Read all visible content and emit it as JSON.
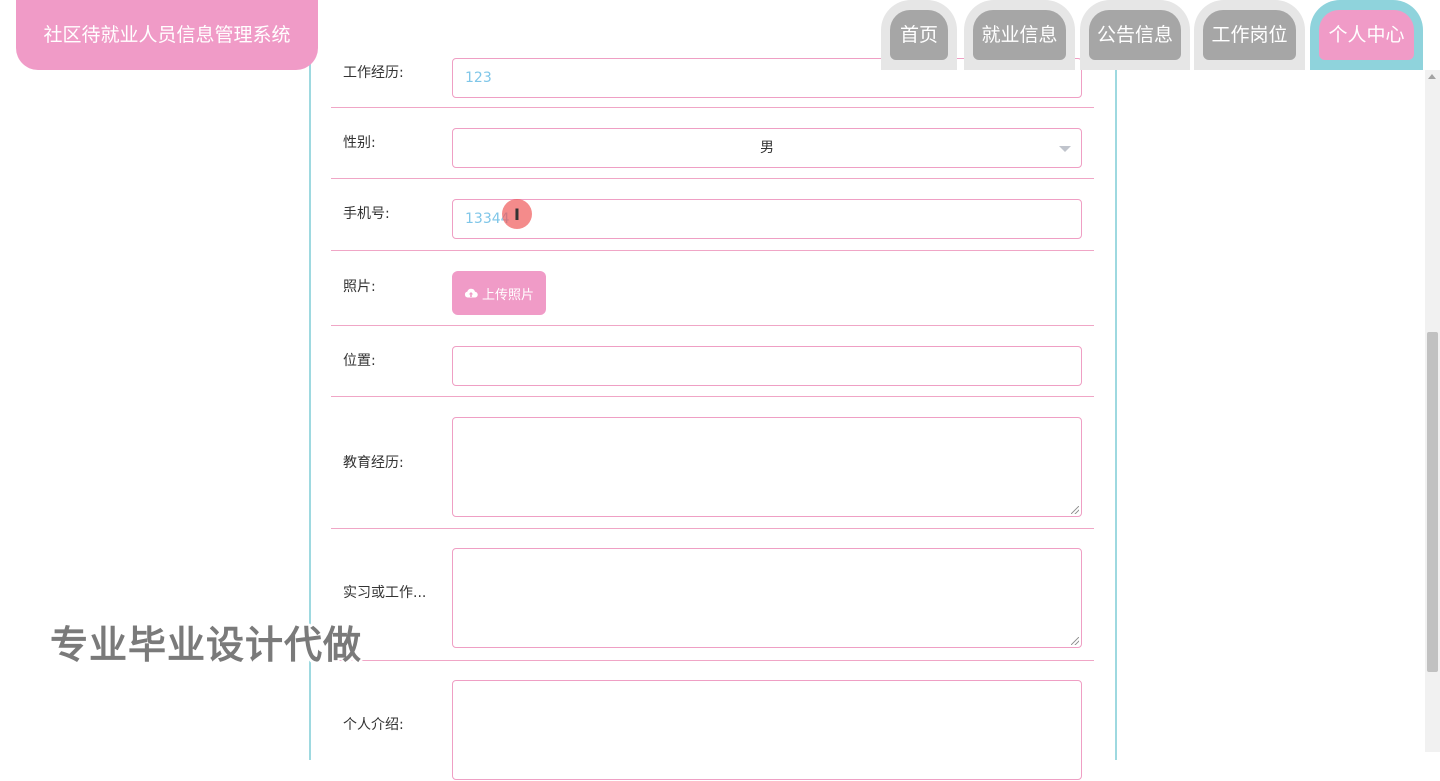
{
  "app": {
    "title": "社区待就业人员信息管理系统"
  },
  "nav": {
    "tabs": [
      {
        "label": "首页"
      },
      {
        "label": "就业信息"
      },
      {
        "label": "公告信息"
      },
      {
        "label": "工作岗位"
      },
      {
        "label": "个人中心",
        "active": true
      }
    ]
  },
  "form": {
    "work_exp": {
      "label": "工作经历:",
      "value": "123"
    },
    "gender": {
      "label": "性别:",
      "value": "男"
    },
    "phone": {
      "label": "手机号:",
      "value": "13344"
    },
    "photo": {
      "label": "照片:",
      "button": "上传照片"
    },
    "location": {
      "label": "位置:",
      "value": ""
    },
    "education": {
      "label": "教育经历:",
      "value": ""
    },
    "internship": {
      "label": "实习或工作...",
      "value": ""
    },
    "intro": {
      "label": "个人介绍:",
      "value": ""
    }
  },
  "watermark": "专业毕业设计代做",
  "colors": {
    "accent_pink": "#f09bc7",
    "accent_cyan": "#8fd3dc",
    "tab_gray": "#a6a6a6"
  }
}
